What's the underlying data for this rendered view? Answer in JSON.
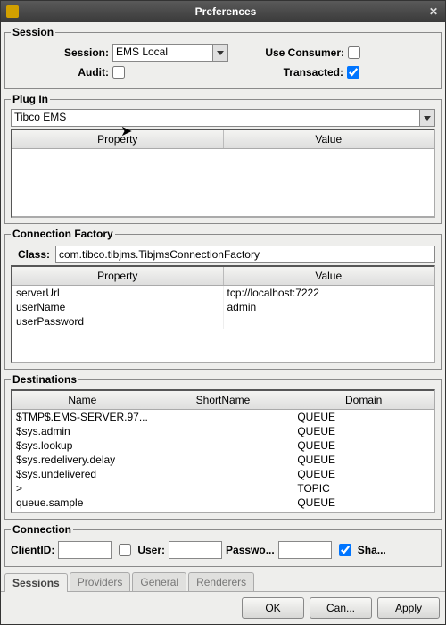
{
  "window": {
    "title": "Preferences"
  },
  "session": {
    "legend": "Session",
    "labels": {
      "session": "Session:",
      "useConsumer": "Use Consumer:",
      "audit": "Audit:",
      "transacted": "Transacted:"
    },
    "selected": "EMS Local",
    "useConsumer": false,
    "audit": false,
    "transacted": true
  },
  "plugin": {
    "legend": "Plug In",
    "selected": "Tibco EMS",
    "columns": [
      "Property",
      "Value"
    ],
    "rows": []
  },
  "connFactory": {
    "legend": "Connection Factory",
    "classLabel": "Class:",
    "classValue": "com.tibco.tibjms.TibjmsConnectionFactory",
    "columns": [
      "Property",
      "Value"
    ],
    "rows": [
      {
        "property": "serverUrl",
        "value": "tcp://localhost:7222"
      },
      {
        "property": "userName",
        "value": "admin"
      },
      {
        "property": "userPassword",
        "value": ""
      }
    ]
  },
  "destinations": {
    "legend": "Destinations",
    "columns": [
      "Name",
      "ShortName",
      "Domain"
    ],
    "rows": [
      {
        "name": "$TMP$.EMS-SERVER.97...",
        "shortName": "",
        "domain": "QUEUE"
      },
      {
        "name": "$sys.admin",
        "shortName": "",
        "domain": "QUEUE"
      },
      {
        "name": "$sys.lookup",
        "shortName": "",
        "domain": "QUEUE"
      },
      {
        "name": "$sys.redelivery.delay",
        "shortName": "",
        "domain": "QUEUE"
      },
      {
        "name": "$sys.undelivered",
        "shortName": "",
        "domain": "QUEUE"
      },
      {
        "name": ">",
        "shortName": "",
        "domain": "TOPIC"
      },
      {
        "name": "queue.sample",
        "shortName": "",
        "domain": "QUEUE"
      }
    ]
  },
  "connection": {
    "legend": "Connection",
    "labels": {
      "clientId": "ClientID:",
      "user": "User:",
      "password": "Passwo...",
      "shared": "Sha..."
    },
    "clientId": "",
    "anonCheck": false,
    "user": "",
    "password": "",
    "shared": true
  },
  "tabs": [
    "Sessions",
    "Providers",
    "General",
    "Renderers"
  ],
  "activeTab": 0,
  "buttons": {
    "ok": "OK",
    "cancel": "Can...",
    "apply": "Apply"
  }
}
